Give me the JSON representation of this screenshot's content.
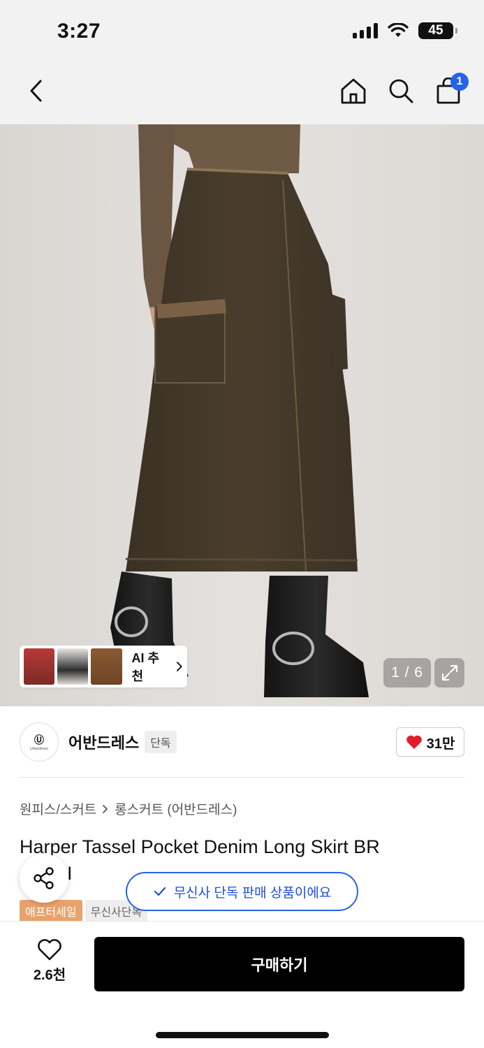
{
  "status_bar": {
    "time": "3:27",
    "battery": "45"
  },
  "nav": {
    "cart_count": "1"
  },
  "gallery": {
    "counter": "1 / 6",
    "ai_label": "AI 추천"
  },
  "brand": {
    "name": "어반드레스",
    "tag": "단독",
    "logo_text": "Urbandress",
    "likes": "31만"
  },
  "breadcrumb": {
    "category": "원피스/스커트",
    "subcategory": "롱스커트 (어반드레스)"
  },
  "product": {
    "title": "Harper Tassel Pocket Denim Long Skirt BR",
    "title_tail": "I"
  },
  "toast": {
    "text": "무신사 단독 판매 상품이에요"
  },
  "badges": {
    "sale": "애프터세일",
    "exclusive": "무신사단독"
  },
  "bottom": {
    "wish_count": "2.6천",
    "buy_label": "구매하기"
  },
  "colors": {
    "accent_blue": "#2563eb",
    "heart_red": "#e11d2a",
    "sale_orange": "#e8a36c"
  }
}
